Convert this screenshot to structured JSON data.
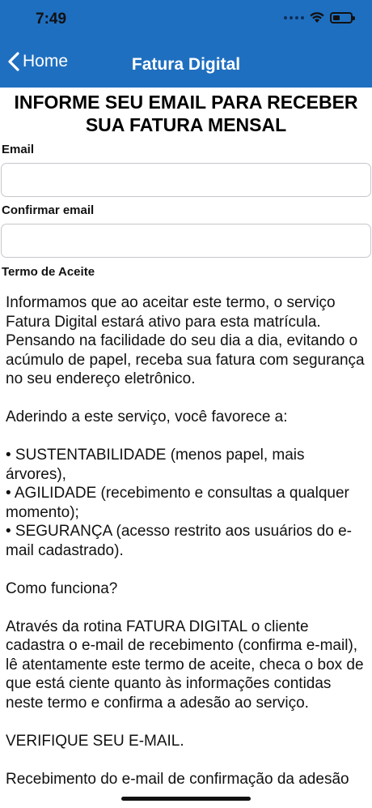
{
  "status_bar": {
    "time": "7:49"
  },
  "nav": {
    "back_label": "Home",
    "title": "Fatura Digital"
  },
  "heading": "INFORME SEU EMAIL PARA RECEBER SUA FATURA MENSAL",
  "form": {
    "email_label": "Email",
    "email_value": "",
    "confirm_label": "Confirmar email",
    "confirm_value": "",
    "terms_label": "Termo de Aceite"
  },
  "terms": {
    "p1": "Informamos que ao aceitar este termo, o serviço Fatura Digital estará ativo para esta matrícula. Pensando na facilidade do seu dia a dia, evitando o acúmulo de papel, receba sua fatura com segurança no seu endereço eletrônico.",
    "p2": "Aderindo a este serviço, você favorece a:",
    "bullet1": "• SUSTENTABILIDADE (menos papel, mais árvores),",
    "bullet2": "• AGILIDADE (recebimento e consultas a qualquer momento);",
    "bullet3": "• SEGURANÇA (acesso restrito aos usuários do e-mail cadastrado).",
    "p3": "Como funciona?",
    "p4": "Através da rotina FATURA DIGITAL o cliente cadastra o e-mail de recebimento (confirma e-mail), lê atentamente este termo de aceite, checa o box de que está ciente quanto às informações contidas neste termo e confirma a adesão ao serviço.",
    "p5": "VERIFIQUE SEU E-MAIL.",
    "p6": "Recebimento do e-mail de confirmação da adesão"
  },
  "colors": {
    "header_bg": "#1f6fc0",
    "header_text": "#ffffff"
  }
}
